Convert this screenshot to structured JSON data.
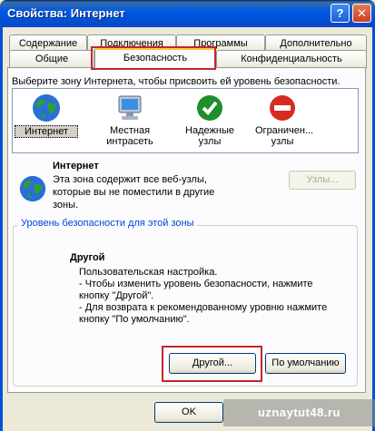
{
  "window": {
    "title": "Свойства: Интернет"
  },
  "tabs": {
    "row1": [
      "Содержание",
      "Подключения",
      "Программы",
      "Дополнительно"
    ],
    "row2": [
      "Общие",
      "Безопасность",
      "Конфиденциальность"
    ]
  },
  "zones": {
    "prompt": "Выберите зону Интернета, чтобы присвоить ей уровень безопасности.",
    "items": [
      {
        "label": "Интернет",
        "icon": "globe-icon"
      },
      {
        "label": "Местная интрасеть",
        "icon": "computer-icon"
      },
      {
        "label": "Надежные узлы",
        "icon": "checkmark-icon"
      },
      {
        "label": "Ограничен... узлы",
        "icon": "no-entry-icon"
      }
    ]
  },
  "zone_info": {
    "title": "Интернет",
    "description": "Эта зона содержит все веб-узлы, которые вы не поместили в другие зоны.",
    "sites_button": "Узлы..."
  },
  "security_level": {
    "group_label": "Уровень безопасности для этой зоны",
    "level_name": "Другой",
    "level_description": "Пользовательская настройка.\n- Чтобы изменить уровень безопасности, нажмите\n  кнопку \"Другой\".\n- Для возврата к рекомендованному уровню нажмите\n  кнопку \"По умолчанию\".",
    "custom_button": "Другой...",
    "default_button": "По умолчанию"
  },
  "footer": {
    "ok_button": "OK"
  },
  "watermark": "uznaytut48.ru",
  "colors": {
    "accent_red": "#c0282d",
    "title_blue": "#0052d6"
  }
}
